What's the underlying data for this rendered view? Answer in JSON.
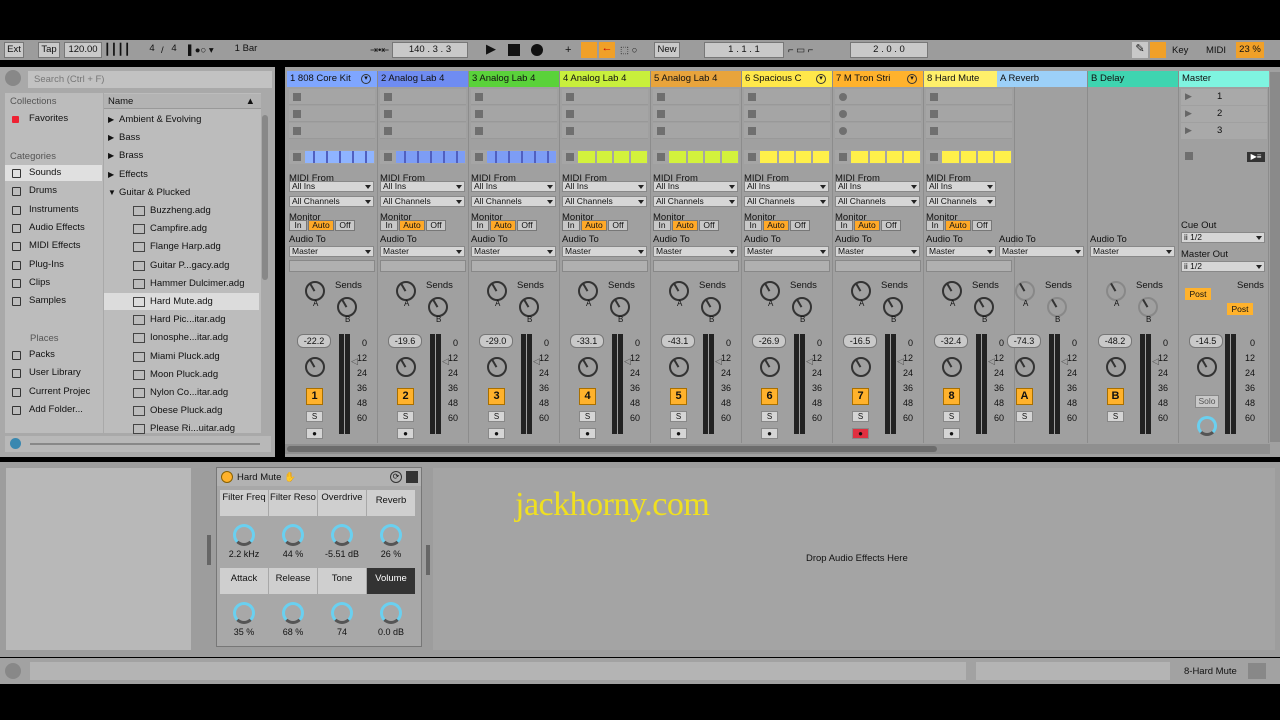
{
  "toolbar": {
    "ext": "Ext",
    "tap": "Tap",
    "tempo": "120.00",
    "sig_num": "4",
    "sig_den": "4",
    "quant": "1 Bar",
    "pos": "140 .  3 .  3",
    "new": "New",
    "loop_start": "1 .  1 .  1",
    "loop_len": "2 .  0 .  0",
    "key": "Key",
    "midi": "MIDI",
    "cpu": "23 %"
  },
  "browser": {
    "search_placeholder": "Search (Ctrl + F)",
    "collections_label": "Collections",
    "favorites": "Favorites",
    "categories_label": "Categories",
    "categories": [
      "Sounds",
      "Drums",
      "Instruments",
      "Audio Effects",
      "MIDI Effects",
      "Plug-Ins",
      "Clips",
      "Samples"
    ],
    "places_label": "Places",
    "places": [
      "Packs",
      "User Library",
      "Current Projec",
      "Add Folder..."
    ],
    "name_header": "Name",
    "folders": [
      "Ambient & Evolving",
      "Bass",
      "Brass",
      "Effects",
      "Guitar & Plucked"
    ],
    "files": [
      "Buzzheng.adg",
      "Campfire.adg",
      "Flange Harp.adg",
      "Guitar P...gacy.adg",
      "Hammer Dulcimer.adg",
      "Hard Mute.adg",
      "Hard Pic...itar.adg",
      "Ionosphe...itar.adg",
      "Miami Pluck.adg",
      "Moon Pluck.adg",
      "Nylon Co...itar.adg",
      "Obese Pluck.adg",
      "Please Ri...uitar.adg"
    ]
  },
  "tracks": [
    {
      "name": "1 808 Core Kit",
      "color": "#7fa6ff",
      "vol": "-22.2",
      "num": "1"
    },
    {
      "name": "2 Analog Lab 4",
      "color": "#6f8cf2",
      "vol": "-19.6",
      "num": "2"
    },
    {
      "name": "3 Analog Lab 4",
      "color": "#5ad23a",
      "vol": "-29.0",
      "num": "3"
    },
    {
      "name": "4 Analog Lab 4",
      "color": "#c8ef3c",
      "vol": "-33.1",
      "num": "4"
    },
    {
      "name": "5 Analog Lab 4",
      "color": "#e8a43c",
      "vol": "-43.1",
      "num": "5"
    },
    {
      "name": "6 Spacious C",
      "color": "#ffe84a",
      "vol": "-26.9",
      "num": "6"
    },
    {
      "name": "7 M Tron Stri",
      "color": "#ffb22c",
      "vol": "-16.5",
      "num": "7"
    },
    {
      "name": "8 Hard Mute",
      "color": "#fff06a",
      "vol": "-32.4",
      "num": "8"
    }
  ],
  "returns": [
    {
      "name": "A Reverb",
      "color": "#9cd0f8",
      "vol": "-74.3",
      "num": "A"
    },
    {
      "name": "B Delay",
      "color": "#3fd4b0",
      "vol": "-48.2",
      "num": "B"
    }
  ],
  "master": {
    "name": "Master",
    "color": "#7ff4e0",
    "vol": "-14.5",
    "scenes": [
      "1",
      "2",
      "3"
    ],
    "cue_out_label": "Cue Out",
    "cue_out": "ii 1/2",
    "master_out_label": "Master Out",
    "master_out": "ii 1/2",
    "post": "Post",
    "solo": "Solo"
  },
  "io": {
    "midi_from": "MIDI From",
    "all_ins": "All Ins",
    "all_channels": "All Channels",
    "monitor": "Monitor",
    "in": "In",
    "auto": "Auto",
    "off": "Off",
    "audio_to": "Audio To",
    "master": "Master",
    "sends": "Sends",
    "s": "S"
  },
  "scale": [
    "0",
    "12",
    "24",
    "36",
    "48",
    "60"
  ],
  "device": {
    "title": "Hard Mute",
    "macros": [
      {
        "label": "Filter Freq",
        "value": "2.2 kHz"
      },
      {
        "label": "Filter Reso",
        "value": "44 %"
      },
      {
        "label": "Overdrive",
        "value": "-5.51 dB"
      },
      {
        "label": "Reverb",
        "value": "26 %"
      },
      {
        "label": "Attack",
        "value": "35 %"
      },
      {
        "label": "Release",
        "value": "68 %"
      },
      {
        "label": "Tone",
        "value": "74"
      },
      {
        "label": "Volume",
        "value": "0.0 dB"
      }
    ]
  },
  "drop_text": "Drop Audio Effects Here",
  "watermark": "jackhorny.com",
  "status": "8-Hard Mute"
}
